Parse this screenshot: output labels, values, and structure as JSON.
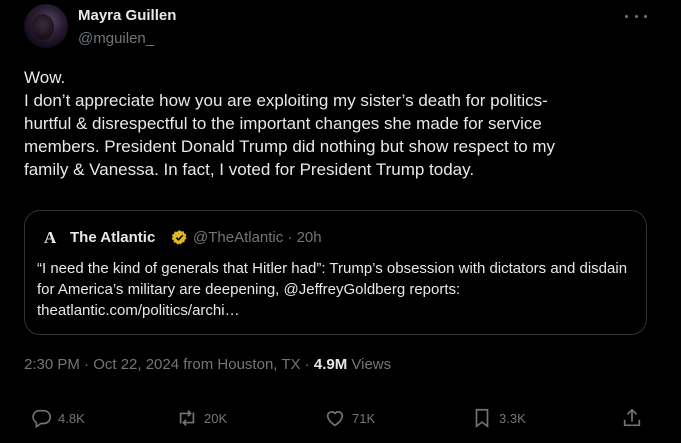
{
  "author": {
    "name": "Mayra Guillen",
    "handle": "@mguilen_"
  },
  "tweet": {
    "text": "Wow.\nI don’t appreciate how you are exploiting my sister’s death for politics-\nhurtful & disrespectful to the important changes she made for service\nmembers. President Donald Trump did nothing but show respect to my\nfamily & Vanessa. In fact, I voted for President Trump today."
  },
  "quoted": {
    "logo": "A",
    "name": "The Atlantic",
    "handle_time": "@TheAtlantic · 20h",
    "text": "“I need the kind of generals that Hitler had”: Trump’s obsession with dictators and disdain for America’s military are deepening, @JeffreyGoldberg reports: theatlantic.com/politics/archi…",
    "badge_color": "#e2b719"
  },
  "meta": {
    "timestamp": "2:30 PM · Oct 22, 2024 from Houston, TX · ",
    "views_count": "4.9M",
    "views_label": " Views"
  },
  "actions": {
    "replies": "4.8K",
    "reposts": "20K",
    "likes": "71K",
    "bookmarks": "3.3K"
  },
  "colors": {
    "background": "#000000",
    "text": "#e7e9ea",
    "muted": "#71767b",
    "border": "#2f3336"
  },
  "icons": [
    "more-icon",
    "verified-gold-badge-icon",
    "reply-icon",
    "repost-icon",
    "like-icon",
    "bookmark-icon",
    "share-icon"
  ]
}
